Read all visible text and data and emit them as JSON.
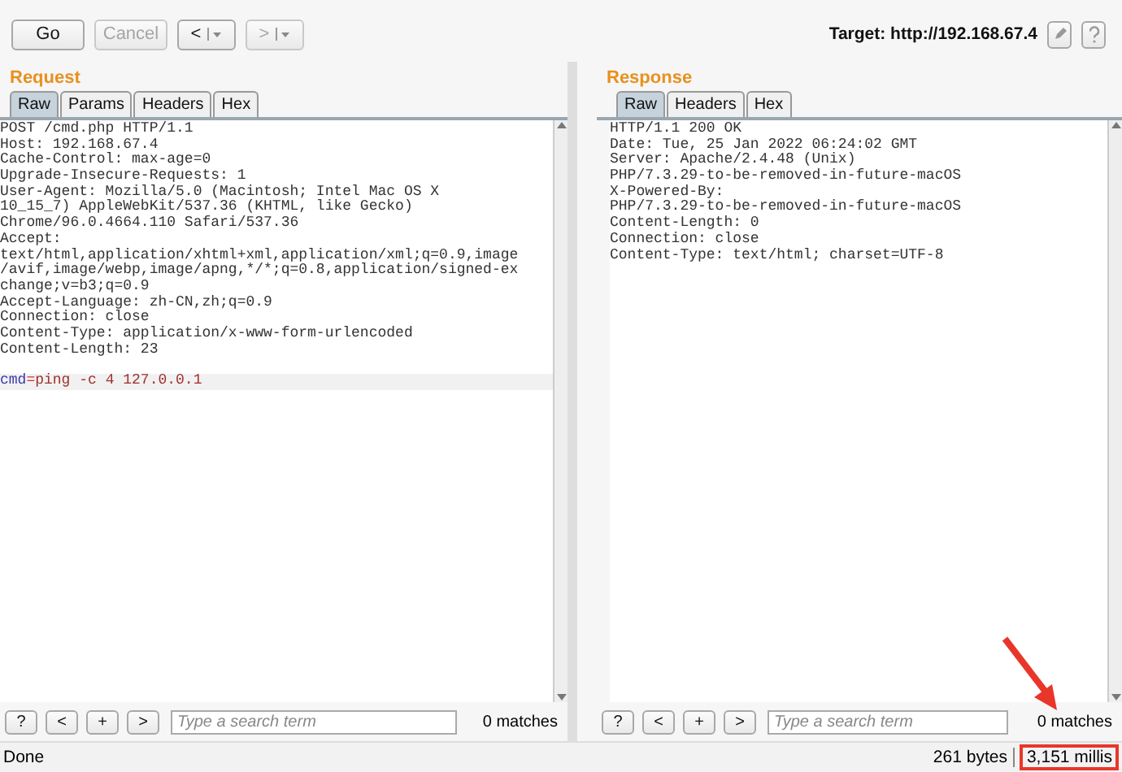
{
  "toolbar": {
    "buttons": [
      {
        "label": "Go",
        "disabled": false
      },
      {
        "label": "Cancel",
        "disabled": true
      }
    ],
    "nav": [
      {
        "label": "<",
        "disabled": false
      },
      {
        "label": ">",
        "disabled": true
      }
    ],
    "target": "Target: http://192.168.67.4"
  },
  "request": {
    "title": "Request",
    "tabs": [
      {
        "label": "Raw",
        "selected": true
      },
      {
        "label": "Params",
        "selected": false
      },
      {
        "label": "Headers",
        "selected": false
      },
      {
        "label": "Hex",
        "selected": false
      }
    ],
    "lines": [
      "POST /cmd.php HTTP/1.1",
      "Host: 192.168.67.4",
      "Cache-Control: max-age=0",
      "Upgrade-Insecure-Requests: 1",
      "User-Agent: Mozilla/5.0 (Macintosh; Intel Mac OS X",
      "10_15_7) AppleWebKit/537.36 (KHTML, like Gecko)",
      "Chrome/96.0.4664.110 Safari/537.36",
      "Accept:",
      "text/html,application/xhtml+xml,application/xml;q=0.9,image",
      "/avif,image/webp,image/apng,*/*;q=0.8,application/signed-ex",
      "change;v=b3;q=0.9",
      "Accept-Language: zh-CN,zh;q=0.9",
      "Connection: close",
      "Content-Type: application/x-www-form-urlencoded",
      "Content-Length: 23"
    ],
    "body": {
      "name": "cmd",
      "separator": "=",
      "value": "ping -c 4 127.0.0.1"
    },
    "search": {
      "buttons": [
        "?",
        "<",
        "+",
        ">"
      ],
      "placeholder": "Type a search term",
      "matches": "0 matches"
    }
  },
  "response": {
    "title": "Response",
    "tabs": [
      {
        "label": "Raw",
        "selected": true
      },
      {
        "label": "Headers",
        "selected": false
      },
      {
        "label": "Hex",
        "selected": false
      }
    ],
    "lines": [
      "HTTP/1.1 200 OK",
      "Date: Tue, 25 Jan 2022 06:24:02 GMT",
      "Server: Apache/2.4.48 (Unix)",
      "PHP/7.3.29-to-be-removed-in-future-macOS",
      "X-Powered-By:",
      "PHP/7.3.29-to-be-removed-in-future-macOS",
      "Content-Length: 0",
      "Connection: close",
      "Content-Type: text/html; charset=UTF-8"
    ],
    "search": {
      "buttons": [
        "?",
        "<",
        "+",
        ">"
      ],
      "placeholder": "Type a search term",
      "matches": "0 matches"
    }
  },
  "status_bar": {
    "left": "Done",
    "bytes": "261 bytes",
    "time": "3,151 millis"
  }
}
